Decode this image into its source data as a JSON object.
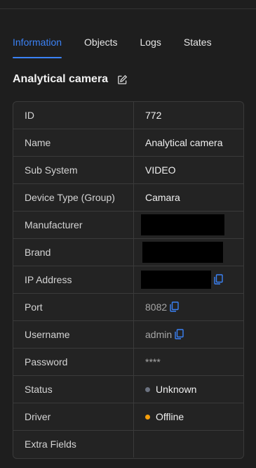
{
  "tabs": [
    {
      "label": "Information",
      "active": true
    },
    {
      "label": "Objects",
      "active": false
    },
    {
      "label": "Logs",
      "active": false
    },
    {
      "label": "States",
      "active": false
    }
  ],
  "title": "Analytical camera",
  "fields": {
    "id": {
      "label": "ID",
      "value": "772"
    },
    "name": {
      "label": "Name",
      "value": "Analytical camera"
    },
    "subsystem": {
      "label": "Sub System",
      "value": "VIDEO"
    },
    "device_type": {
      "label": "Device Type (Group)",
      "value": "Camara"
    },
    "manufacturer": {
      "label": "Manufacturer",
      "value": ""
    },
    "brand": {
      "label": "Brand",
      "value": ""
    },
    "ip_address": {
      "label": "IP Address",
      "value": ""
    },
    "port": {
      "label": "Port",
      "value": "8082"
    },
    "username": {
      "label": "Username",
      "value": "admin"
    },
    "password": {
      "label": "Password",
      "value": "****"
    },
    "status": {
      "label": "Status",
      "value": "Unknown",
      "dot_color": "#6b7280"
    },
    "driver": {
      "label": "Driver",
      "value": "Offline",
      "dot_color": "#f59e0b"
    },
    "extra_fields": {
      "label": "Extra Fields",
      "value": ""
    }
  },
  "colors": {
    "accent": "#3b82f6",
    "background": "#1e1e1e"
  }
}
